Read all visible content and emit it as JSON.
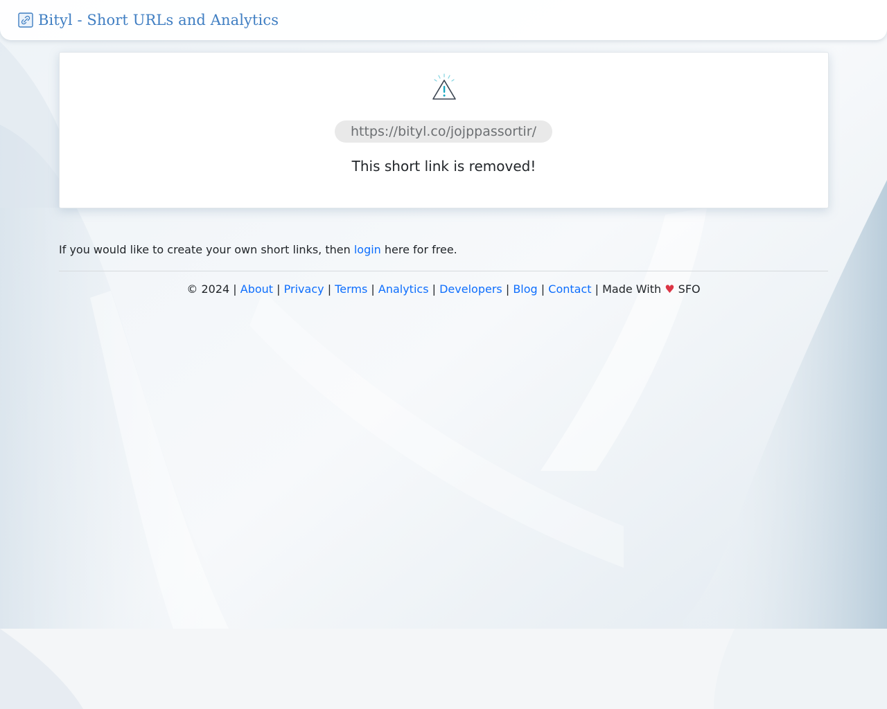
{
  "header": {
    "brand": "Bityl - Short URLs and Analytics",
    "brand_icon": "link-icon"
  },
  "card": {
    "icon": "warning-icon",
    "short_url": "https://bityl.co/jojppassortir/",
    "message": "This short link is removed!"
  },
  "promo": {
    "text_before": "If you would like to create your own short links, then",
    "link": "login",
    "text_after": "here for free."
  },
  "footer": {
    "copyright": "© 2024",
    "links": [
      "About",
      "Privacy",
      "Terms",
      "Analytics",
      "Developers",
      "Blog",
      "Contact"
    ],
    "made_with": "Made With",
    "heart": "♥",
    "location": "SFO",
    "separator": "|"
  },
  "colors": {
    "brand": "#3f7ec2",
    "link": "#0d6efd",
    "heart": "#dc3545"
  }
}
